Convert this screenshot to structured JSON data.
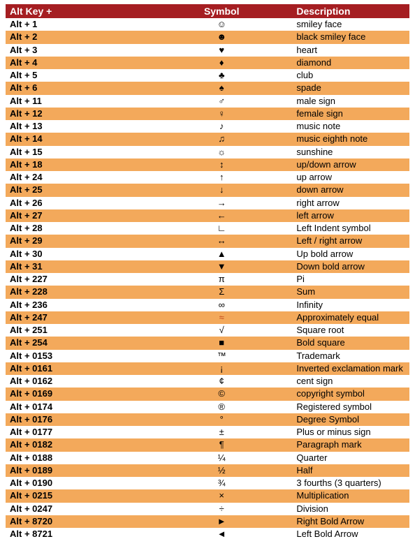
{
  "headers": {
    "key": "Alt Key +",
    "symbol": "Symbol",
    "desc": "Description"
  },
  "rows": [
    {
      "key": "Alt + 1",
      "sym": "☺",
      "desc": "smiley face",
      "red": false
    },
    {
      "key": "Alt + 2",
      "sym": "☻",
      "desc": "black smiley face",
      "red": false
    },
    {
      "key": "Alt + 3",
      "sym": "♥",
      "desc": "heart",
      "red": false
    },
    {
      "key": "Alt + 4",
      "sym": "♦",
      "desc": "diamond",
      "red": false
    },
    {
      "key": "Alt + 5",
      "sym": "♣",
      "desc": "club",
      "red": false
    },
    {
      "key": "Alt + 6",
      "sym": "♠",
      "desc": "spade",
      "red": false
    },
    {
      "key": "Alt + 11",
      "sym": "♂",
      "desc": "male sign",
      "red": false
    },
    {
      "key": "Alt + 12",
      "sym": "♀",
      "desc": "female sign",
      "red": false
    },
    {
      "key": "Alt + 13",
      "sym": "♪",
      "desc": "music note",
      "red": false
    },
    {
      "key": "Alt + 14",
      "sym": "♫",
      "desc": "music eighth note",
      "red": false
    },
    {
      "key": "Alt + 15",
      "sym": "☼",
      "desc": "sunshine",
      "red": false
    },
    {
      "key": "Alt + 18",
      "sym": "↕",
      "desc": "up/down arrow",
      "red": false
    },
    {
      "key": "Alt + 24",
      "sym": "↑",
      "desc": "up arrow",
      "red": false
    },
    {
      "key": "Alt + 25",
      "sym": "↓",
      "desc": "down arrow",
      "red": false
    },
    {
      "key": "Alt + 26",
      "sym": "→",
      "desc": "right arrow",
      "red": false
    },
    {
      "key": "Alt + 27",
      "sym": "←",
      "desc": "left arrow",
      "red": false
    },
    {
      "key": "Alt + 28",
      "sym": "∟",
      "desc": "Left Indent symbol",
      "red": false
    },
    {
      "key": "Alt + 29",
      "sym": "↔",
      "desc": "Left / right arrow",
      "red": false
    },
    {
      "key": "Alt + 30",
      "sym": "▲",
      "desc": "Up bold arrow",
      "red": false
    },
    {
      "key": "Alt + 31",
      "sym": "▼",
      "desc": "Down bold arrow",
      "red": false
    },
    {
      "key": "Alt + 227",
      "sym": "π",
      "desc": "Pi",
      "red": false
    },
    {
      "key": "Alt + 228",
      "sym": "Σ",
      "desc": "Sum",
      "red": false
    },
    {
      "key": "Alt + 236",
      "sym": "∞",
      "desc": "Infinity",
      "red": false
    },
    {
      "key": "Alt + 247",
      "sym": "≈",
      "desc": "Approximately equal",
      "red": true
    },
    {
      "key": "Alt + 251",
      "sym": "√",
      "desc": "Square root",
      "red": false
    },
    {
      "key": "Alt + 254",
      "sym": "■",
      "desc": "Bold square",
      "red": false
    },
    {
      "key": "Alt + 0153",
      "sym": "™",
      "desc": "Trademark",
      "red": false
    },
    {
      "key": "Alt + 0161",
      "sym": "¡",
      "desc": "Inverted exclamation mark",
      "red": false
    },
    {
      "key": "Alt + 0162",
      "sym": "¢",
      "desc": "cent sign",
      "red": false
    },
    {
      "key": "Alt + 0169",
      "sym": "©",
      "desc": "copyright symbol",
      "red": false
    },
    {
      "key": "Alt + 0174",
      "sym": "®",
      "desc": "Registered symbol",
      "red": false
    },
    {
      "key": "Alt + 0176",
      "sym": "°",
      "desc": "Degree Symbol",
      "red": false
    },
    {
      "key": "Alt + 0177",
      "sym": "±",
      "desc": "Plus or minus sign",
      "red": false
    },
    {
      "key": "Alt + 0182",
      "sym": "¶",
      "desc": "Paragraph mark",
      "red": false
    },
    {
      "key": "Alt + 0188",
      "sym": "¼",
      "desc": "Quarter",
      "red": false
    },
    {
      "key": "Alt + 0189",
      "sym": "½",
      "desc": "Half",
      "red": false
    },
    {
      "key": "Alt + 0190",
      "sym": "¾",
      "desc": "3 fourths (3 quarters)",
      "red": false
    },
    {
      "key": "Alt + 0215",
      "sym": "×",
      "desc": "Multiplication",
      "red": false
    },
    {
      "key": "Alt + 0247",
      "sym": "÷",
      "desc": "Division",
      "red": false
    },
    {
      "key": "Alt + 8720",
      "sym": "►",
      "desc": "Right Bold Arrow",
      "red": false
    },
    {
      "key": "Alt + 8721",
      "sym": "◄",
      "desc": "Left Bold Arrow",
      "red": false
    }
  ]
}
